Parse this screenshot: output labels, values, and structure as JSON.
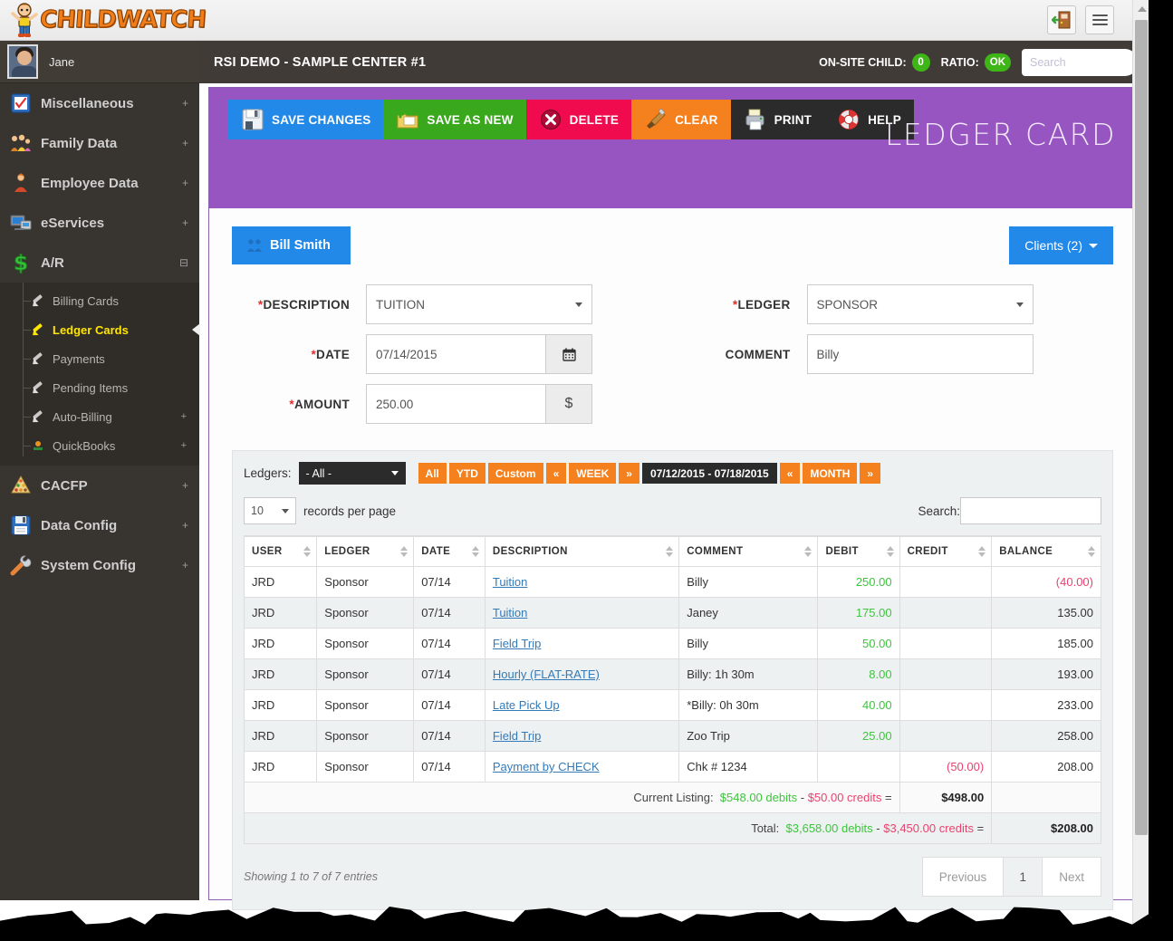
{
  "brand": {
    "name": "CHILDWATCH",
    "logo_icon": "child-mascot-icon"
  },
  "topbar": {
    "exit_icon": "exit-door-icon",
    "menu_icon": "hamburger-menu-icon"
  },
  "user": {
    "name": "Jane",
    "avatar_icon": "user-avatar"
  },
  "sidebar": {
    "items": [
      {
        "label": "Miscellaneous",
        "icon": "clipboard-check-icon",
        "expander": "+",
        "active": false
      },
      {
        "label": "Family Data",
        "icon": "family-icon",
        "expander": "+",
        "active": false
      },
      {
        "label": "Employee Data",
        "icon": "employee-icon",
        "expander": "+",
        "active": false
      },
      {
        "label": "eServices",
        "icon": "computer-icon",
        "expander": "+",
        "active": false
      },
      {
        "label": "A/R",
        "icon": "dollar-sign-icon",
        "expander": "⊟",
        "active": true
      }
    ],
    "sub_items": [
      {
        "label": "Billing Cards",
        "icon": "pencil-icon",
        "expander": "",
        "active": false
      },
      {
        "label": "Ledger Cards",
        "icon": "pencil-icon",
        "expander": "",
        "active": true
      },
      {
        "label": "Payments",
        "icon": "pencil-icon",
        "expander": "",
        "active": false
      },
      {
        "label": "Pending Items",
        "icon": "pencil-icon",
        "expander": "",
        "active": false
      },
      {
        "label": "Auto-Billing",
        "icon": "pencil-icon",
        "expander": "+",
        "active": false
      },
      {
        "label": "QuickBooks",
        "icon": "quickbooks-icon",
        "expander": "+",
        "active": false
      }
    ],
    "items_bottom": [
      {
        "label": "CACFP",
        "icon": "food-pyramid-icon",
        "expander": "+",
        "active": false
      },
      {
        "label": "Data Config",
        "icon": "floppy-disk-icon",
        "expander": "+",
        "active": false
      },
      {
        "label": "System Config",
        "icon": "wrench-icon",
        "expander": "+",
        "active": false
      }
    ]
  },
  "header": {
    "center_name": "RSI DEMO - SAMPLE CENTER #1",
    "onsite_label": "ON-SITE CHILD:",
    "onsite_value": "0",
    "ratio_label": "RATIO:",
    "ratio_value": "OK",
    "search_placeholder": "Search",
    "search_value": "",
    "search_icon": "magnifier-icon",
    "badge_color": "#3fb618"
  },
  "page": {
    "title": "LEDGER CARD",
    "accent_color": "#9655c0",
    "toolbar": [
      {
        "label": "SAVE CHANGES",
        "icon": "floppy-disk-icon",
        "color": "#2389e8"
      },
      {
        "label": "SAVE AS NEW",
        "icon": "new-folder-icon",
        "color": "#3aa81d"
      },
      {
        "label": "DELETE",
        "icon": "delete-x-icon",
        "color": "#ef0b4e"
      },
      {
        "label": "CLEAR",
        "icon": "brush-icon",
        "color": "#f5801e"
      },
      {
        "label": "PRINT",
        "icon": "printer-icon",
        "color": "#2b2b2b"
      },
      {
        "label": "HELP",
        "icon": "life-ring-icon",
        "color": "#2b2b2b"
      }
    ]
  },
  "record": {
    "client_tab": "Bill Smith",
    "client_tab_icon": "people-icon",
    "clients_button": "Clients (2)",
    "fields": {
      "description_label": "DESCRIPTION",
      "description_value": "TUITION",
      "date_label": "DATE",
      "date_value": "07/14/2015",
      "date_icon": "calendar-icon",
      "amount_label": "AMOUNT",
      "amount_value": "250.00",
      "amount_icon": "dollar-icon",
      "ledger_label": "LEDGER",
      "ledger_value": "SPONSOR",
      "comment_label": "COMMENT",
      "comment_value": "Billy"
    }
  },
  "ledger_panel": {
    "ledgers_label": "Ledgers:",
    "ledgers_value": "- All -",
    "range_buttons": [
      "All",
      "YTD",
      "Custom"
    ],
    "week_prev": "«",
    "week_label": "WEEK",
    "week_next": "»",
    "date_range": "07/12/2015 - 07/18/2015",
    "month_prev": "«",
    "month_label": "MONTH",
    "month_next": "»",
    "page_length": "10",
    "page_length_suffix": "records per page",
    "search_label": "Search:",
    "search_value": "",
    "columns": [
      "USER",
      "LEDGER",
      "DATE",
      "DESCRIPTION",
      "COMMENT",
      "DEBIT",
      "CREDIT",
      "BALANCE"
    ],
    "rows": [
      {
        "user": "JRD",
        "ledger": "Sponsor",
        "date": "07/14",
        "description": "Tuition",
        "comment": "Billy",
        "debit": "250.00",
        "credit": "",
        "balance": "(40.00)",
        "balance_negative": true
      },
      {
        "user": "JRD",
        "ledger": "Sponsor",
        "date": "07/14",
        "description": "Tuition",
        "comment": "Janey",
        "debit": "175.00",
        "credit": "",
        "balance": "135.00",
        "balance_negative": false
      },
      {
        "user": "JRD",
        "ledger": "Sponsor",
        "date": "07/14",
        "description": "Field Trip",
        "comment": "Billy",
        "debit": "50.00",
        "credit": "",
        "balance": "185.00",
        "balance_negative": false
      },
      {
        "user": "JRD",
        "ledger": "Sponsor",
        "date": "07/14",
        "description": "Hourly (FLAT-RATE)",
        "comment": "Billy: 1h 30m",
        "debit": "8.00",
        "credit": "",
        "balance": "193.00",
        "balance_negative": false
      },
      {
        "user": "JRD",
        "ledger": "Sponsor",
        "date": "07/14",
        "description": "Late Pick Up",
        "comment": "*Billy: 0h 30m",
        "debit": "40.00",
        "credit": "",
        "balance": "233.00",
        "balance_negative": false
      },
      {
        "user": "JRD",
        "ledger": "Sponsor",
        "date": "07/14",
        "description": "Field Trip",
        "comment": "Zoo Trip",
        "debit": "25.00",
        "credit": "",
        "balance": "258.00",
        "balance_negative": false
      },
      {
        "user": "JRD",
        "ledger": "Sponsor",
        "date": "07/14",
        "description": "Payment by CHECK",
        "comment": "Chk # 1234",
        "debit": "",
        "credit": "(50.00)",
        "balance": "208.00",
        "balance_negative": false
      }
    ],
    "summary": {
      "current_label": "Current Listing:",
      "current_debits": "$548.00 debits",
      "current_sep": "-",
      "current_credits": "$50.00 credits",
      "current_eq": "=",
      "current_total": "$498.00",
      "total_label": "Total:",
      "total_debits": "$3,658.00 debits",
      "total_sep": "-",
      "total_credits": "$3,450.00 credits",
      "total_eq": "=",
      "total_total": "$208.00"
    },
    "showing": "Showing 1 to 7 of 7 entries",
    "pagination": {
      "previous": "Previous",
      "current": "1",
      "next": "Next"
    }
  }
}
